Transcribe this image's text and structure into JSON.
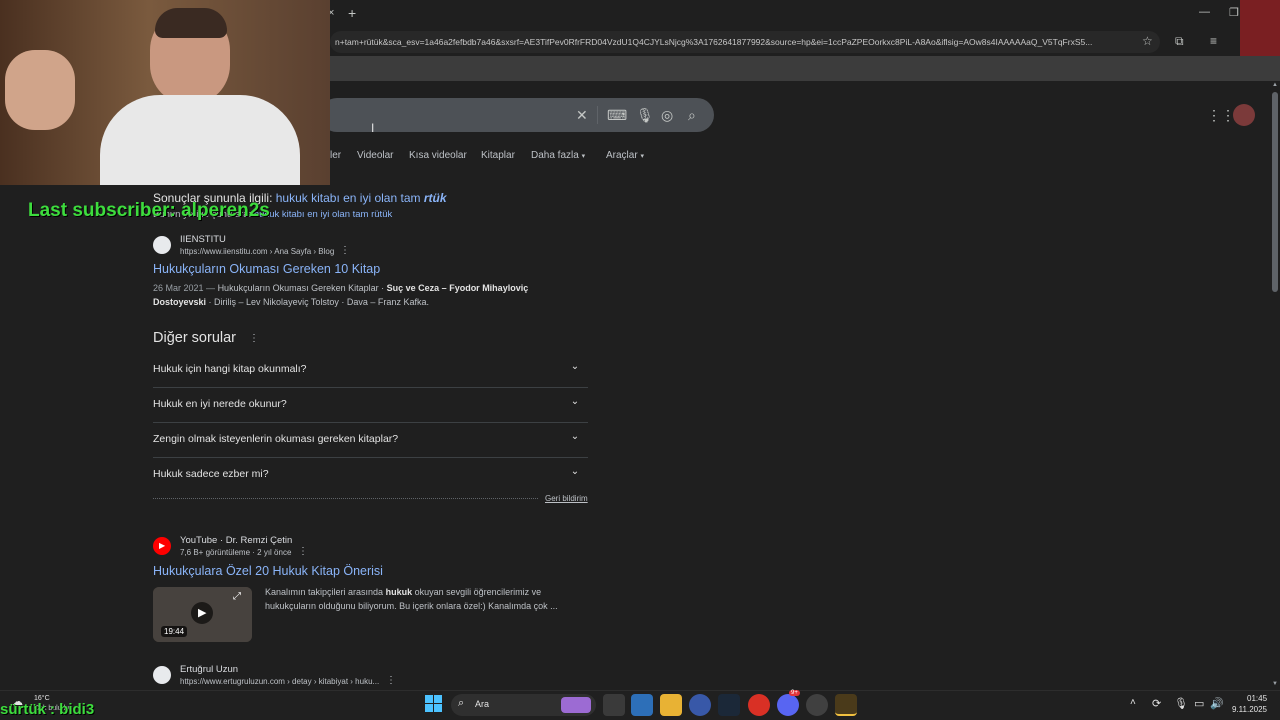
{
  "browser": {
    "url": "n+tam+rütük&sca_esv=1a46a2fefbdb7a46&sxsrf=AE3TifPev0RfrFRD04VzdU1Q4CJYLsNjcg%3A1762641877992&source=hp&ei=1ccPaZPEOorkxc8PiL-A8Ao&iflsig=AOw8s4IAAAAAaQ_V5TqFrxS5...",
    "new_tab": "+",
    "tab_close": "×"
  },
  "search": {
    "tabs": [
      "ler",
      "Videolar",
      "Kısa videolar",
      "Kitaplar",
      "Daha fazla",
      "Araçlar"
    ]
  },
  "correction": {
    "prefix": "Sonuçlar şununla ilgili:",
    "corrected": "hukuk kitabı en iyi olan tam",
    "corrected_bold": "rtük",
    "alt_prefix": "Bunun yerine şunu ara:",
    "alt_query": "hukuk kitabı en iyi olan tam rütük"
  },
  "result1": {
    "site": "IIENSTITU",
    "breadcrumb": "https://www.iienstitu.com › Ana Sayfa › Blog",
    "title": "Hukukçuların Okuması Gereken 10 Kitap",
    "snippet_date": "26 Mar 2021 —",
    "snippet_a": "Hukukçuların Okuması Gereken Kitaplar ·",
    "snippet_bold": "Suç ve Ceza – Fyodor Mihayloviç",
    "snippet_bold2": "Dostoyevski",
    "snippet_b": "· Diriliş – Lev Nikolayeviç Tolstoy · Dava – Franz Kafka."
  },
  "faq": {
    "heading": "Diğer sorular",
    "items": [
      "Hukuk için hangi kitap okunmalı?",
      "Hukuk en iyi nerede okunur?",
      "Zengin olmak isteyenlerin okuması gereken kitaplar?",
      "Hukuk sadece ezber mi?"
    ],
    "feedback": "Geri bildirim"
  },
  "result2": {
    "site": "YouTube · Dr. Remzi Çetin",
    "meta": "7,6 B+ görüntüleme · 2 yıl önce",
    "title": "Hukukçulara Özel 20 Hukuk Kitap Önerisi",
    "snippet_a": "Kanalımın takipçileri arasında",
    "snippet_bold": "hukuk",
    "snippet_b": "okuyan sevgili öğrencilerimiz ve",
    "snippet_c": "hukukçuların olduğunu biliyorum. Bu içerik onlara özel:) Kanalımda çok ...",
    "duration": "19:44"
  },
  "result3": {
    "site": "Ertuğrul Uzun",
    "breadcrumb": "https://www.ertugruluzun.com › detay › kitabiyat › huku..."
  },
  "overlay": {
    "subscriber": "Last subscriber: alperen2s",
    "bottom": "sürtük : bidi3"
  },
  "taskbar": {
    "weather_temp": "16°C",
    "weather_desc": "Çok bulutlu",
    "search_placeholder": "Ara",
    "time": "01:45",
    "date": "9.11.2025",
    "badge": "9+"
  }
}
